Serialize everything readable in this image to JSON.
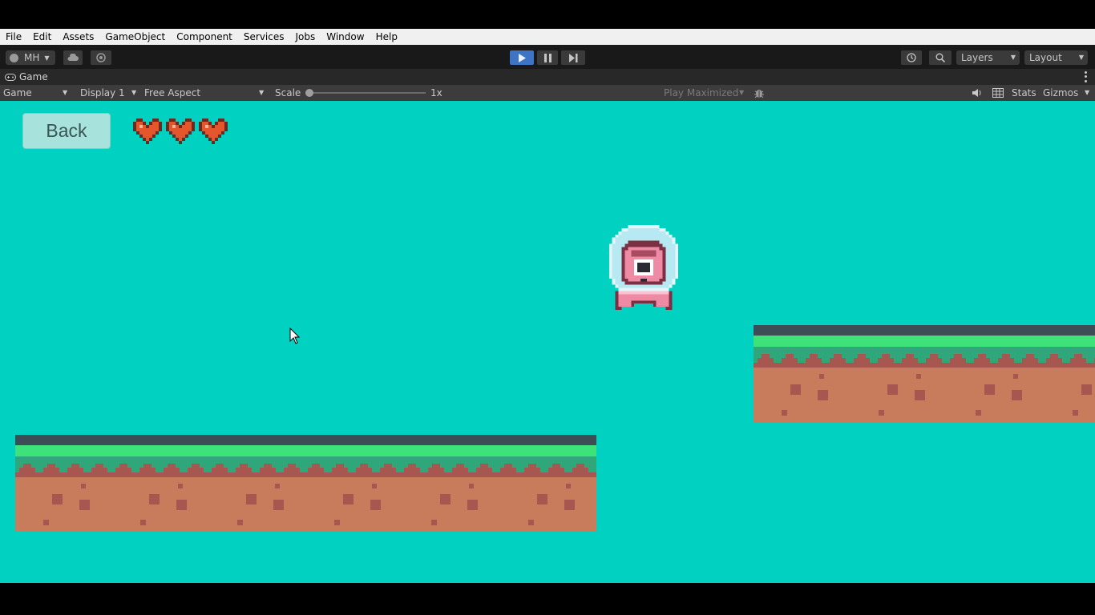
{
  "menu": [
    "File",
    "Edit",
    "Assets",
    "GameObject",
    "Component",
    "Services",
    "Jobs",
    "Window",
    "Help"
  ],
  "toolbar": {
    "account_label": "MH",
    "layers_label": "Layers",
    "layout_label": "Layout"
  },
  "tab": {
    "title": "Game"
  },
  "gamebar": {
    "view_label": "Game",
    "display_label": "Display 1",
    "aspect_label": "Free Aspect",
    "scale_label": "Scale",
    "scale_value": "1x",
    "play_maximized_label": "Play Maximized",
    "stats_label": "Stats",
    "gizmos_label": "Gizmos"
  },
  "game": {
    "back_label": "Back",
    "lives": 3,
    "colors": {
      "sky": "#00d1c1",
      "grass_top": "#3ee27a",
      "grass_dark": "#2fa77a",
      "dirt": "#c97c5b",
      "dirt_spots": "#a75750",
      "platform_top": "#3d4d56",
      "heart": "#e4562b"
    }
  }
}
